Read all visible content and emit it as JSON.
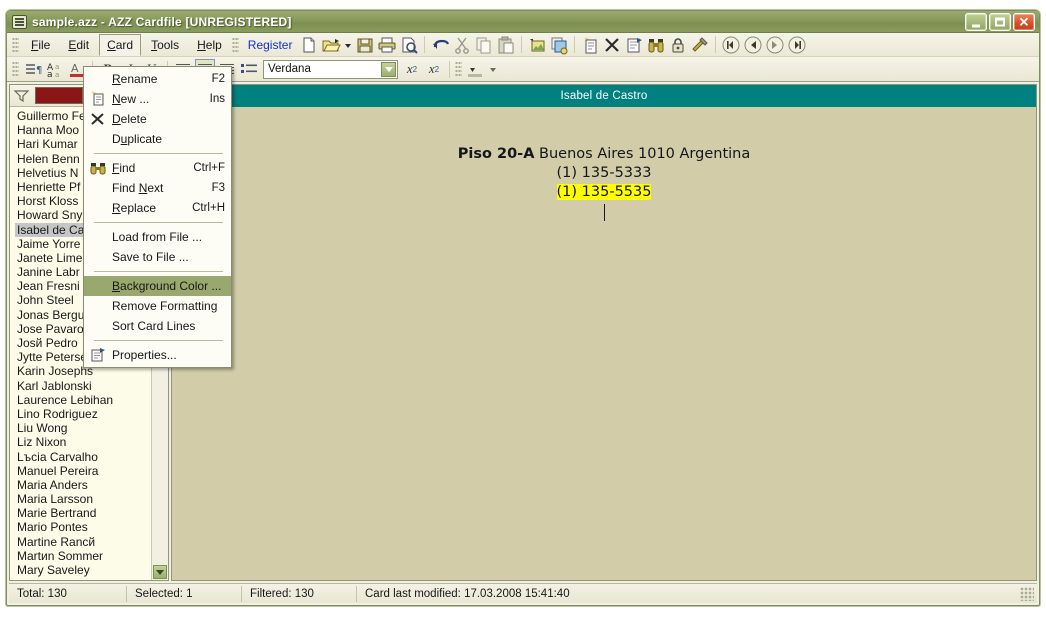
{
  "window": {
    "title": "sample.azz - AZZ Cardfile [UNREGISTERED]",
    "icon": "cardfile-icon",
    "minimize": "–",
    "maximize": "□",
    "close": "✕"
  },
  "menubar": {
    "items": [
      {
        "label": "File",
        "accel": "F",
        "active": false
      },
      {
        "label": "Edit",
        "accel": "E",
        "active": false
      },
      {
        "label": "Card",
        "accel": "C",
        "active": true
      },
      {
        "label": "Tools",
        "accel": "T",
        "active": false
      },
      {
        "label": "Help",
        "accel": "H",
        "active": false
      }
    ],
    "register_label": "Register",
    "toolbar_icons": [
      "new-file-icon",
      "open-folder-icon",
      "open-dropdown-arrow-icon",
      "save-disk-icon",
      "print-icon",
      "print-preview-icon",
      "undo-icon",
      "cut-scissors-icon",
      "copy-icon",
      "paste-icon",
      "insert-image-icon",
      "insert-object-icon",
      "new-card-icon",
      "delete-card-icon",
      "card-properties-icon",
      "find-binoculars-icon",
      "lock-icon",
      "tools-icon",
      "nav-first-icon",
      "nav-previous-icon",
      "nav-next-icon",
      "nav-last-icon"
    ]
  },
  "formatbar": {
    "font_name": "Verdana",
    "buttons": [
      "paragraph-marks-icon",
      "change-case-icon",
      "font-color-icon",
      "bold-icon",
      "italic-icon",
      "underline-icon",
      "align-left-icon",
      "align-center-icon",
      "align-right-icon",
      "bullet-list-icon",
      "superscript-icon",
      "subscript-icon",
      "highlight-color-icon"
    ],
    "bold_label": "B",
    "italic_label": "I",
    "underline_label": "U",
    "superscript_label": "x",
    "superscript_sup": "2",
    "subscript_label": "x",
    "subscript_sub": "2",
    "active_alignment": "align-center"
  },
  "sidebar": {
    "filter_icon": "filter-funnel-icon",
    "color_swatch": "#8a1616",
    "selected_name": "Isabel de Castro",
    "names": [
      "Guillermo Fe",
      "Hanna Moo",
      "Hari Kumar",
      "Helen Benn",
      "Helvetius N",
      "Henriette Pf",
      "Horst Kloss",
      "Howard Sny",
      "Isabel de Ca",
      "Jaime Yorre",
      "Janete Lime",
      "Janine Labr",
      "Jean Fresni",
      "John Steel",
      "Jonas Bergu",
      "Jose Pavaro",
      "Josй Pedro",
      "Jytte Petersen",
      "Karin Josephs",
      "Karl Jablonski",
      "Laurence Lebihan",
      "Lino Rodriguez",
      "Liu Wong",
      "Liz Nixon",
      "Lъcia Carvalho",
      "Manuel Pereira",
      "Maria Anders",
      "Maria Larsson",
      "Marie Bertrand",
      "Mario Pontes",
      "Martine Rancй",
      "Martиn Sommer",
      "Mary Saveley"
    ]
  },
  "card": {
    "header_title": "Isabel de Castro",
    "header_bg": "#00807f",
    "body_bg": "#d2cda8",
    "lines": [
      {
        "segments": [
          {
            "text": "Piso 20-A",
            "bold": true,
            "highlight": false
          },
          {
            "text": " Buenos Aires  1010 Argentina",
            "bold": false,
            "highlight": false
          }
        ]
      },
      {
        "segments": [
          {
            "text": "(1) 135-5333",
            "bold": false,
            "highlight": false
          }
        ]
      },
      {
        "segments": [
          {
            "text": "(1) 135-5535",
            "bold": false,
            "highlight": true
          }
        ]
      }
    ],
    "highlight_color": "#ffff00"
  },
  "card_menu": {
    "items": [
      {
        "label": "Rename",
        "accel_index": 0,
        "shortcut": "F2",
        "icon": null,
        "highlighted": false,
        "separator_after": false
      },
      {
        "label": "New ...",
        "accel_index": 0,
        "shortcut": "Ins",
        "icon": "new-card-icon",
        "highlighted": false,
        "separator_after": false
      },
      {
        "label": "Delete",
        "accel_index": 0,
        "shortcut": "",
        "icon": "delete-x-icon",
        "highlighted": false,
        "separator_after": false
      },
      {
        "label": "Duplicate",
        "accel_index": 1,
        "shortcut": "",
        "icon": null,
        "highlighted": false,
        "separator_after": true
      },
      {
        "label": "Find",
        "accel_index": 0,
        "shortcut": "Ctrl+F",
        "icon": "binoculars-icon",
        "highlighted": false,
        "separator_after": false
      },
      {
        "label": "Find Next",
        "accel_index": 5,
        "shortcut": "F3",
        "icon": null,
        "highlighted": false,
        "separator_after": false
      },
      {
        "label": "Replace",
        "accel_index": 0,
        "shortcut": "Ctrl+H",
        "icon": null,
        "highlighted": false,
        "separator_after": true
      },
      {
        "label": "Load from File ...",
        "accel_index": -1,
        "shortcut": "",
        "icon": null,
        "highlighted": false,
        "separator_after": false
      },
      {
        "label": "Save to File ...",
        "accel_index": -1,
        "shortcut": "",
        "icon": null,
        "highlighted": false,
        "separator_after": true
      },
      {
        "label": "Background Color ...",
        "accel_index": 0,
        "shortcut": "",
        "icon": null,
        "highlighted": true,
        "separator_after": false
      },
      {
        "label": "Remove Formatting",
        "accel_index": -1,
        "shortcut": "",
        "icon": null,
        "highlighted": false,
        "separator_after": false
      },
      {
        "label": "Sort Card Lines",
        "accel_index": -1,
        "shortcut": "",
        "icon": null,
        "highlighted": false,
        "separator_after": true
      },
      {
        "label": "Properties...",
        "accel_index": -1,
        "shortcut": "",
        "icon": "properties-icon",
        "highlighted": false,
        "separator_after": false
      }
    ],
    "highlight_color": "#99a86c"
  },
  "statusbar": {
    "cells": [
      "Total: 130",
      "Selected: 1",
      "Filtered: 130",
      "Card last modified: 17.03.2008  15:41:40"
    ]
  }
}
